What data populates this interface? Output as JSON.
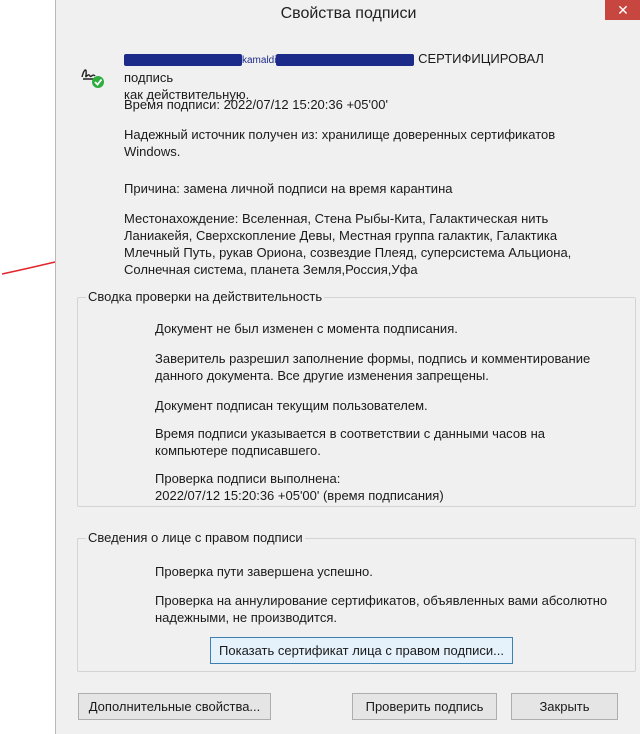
{
  "window": {
    "title": "Свойства подписи",
    "close_glyph": "✕"
  },
  "header": {
    "partial_name": "kamaldi",
    "certified_text": "СЕРТИФИЦИРОВАЛ подпись",
    "certified_text2": "как действительную.",
    "sign_time": "Время подписи:  2022/07/12 15:20:36 +05'00'",
    "trusted_source_1": "Надежный источник получен из: хранилище доверенных сертификатов",
    "trusted_source_2": "Windows.",
    "reason": "Причина:  замена личной подписи на время карантина",
    "location_1": "Местонахождение:  Вселенная, Стена Рыбы-Кита, Галактическая нить",
    "location_2": "Ланиакейя, Сверхскопление Девы, Местная группа галактик, Галактика",
    "location_3": "Млечный Путь, рукав Ориона, созвездие Плеяд, суперсистема Альциона,",
    "location_4": "Солнечная система, планета Земля,Россия,Уфа"
  },
  "validity": {
    "title": "Сводка проверки на действительность",
    "line1": "Документ  не был изменен с момента подписания.",
    "line2a": "Заверитель разрешил заполнение формы, подпись и комментирование",
    "line2b": "данного документа. Все другие изменения запрещены.",
    "line3": "Документ подписан текущим пользователем.",
    "line4a": "Время подписи указывается в соответствии с данными часов на",
    "line4b": "компьютере подписавшего.",
    "line5a": "Проверка подписи выполнена:",
    "line5b": "2022/07/12 15:20:36 +05'00' (время подписания)"
  },
  "signer": {
    "title": "Сведения о лице с правом подписи",
    "line1": "Проверка пути завершена успешно.",
    "line2a": "Проверка на аннулирование сертификатов, объявленных вами абсолютно",
    "line2b": "надежными, не производится.",
    "show_cert_button": "Показать сертификат лица с правом подписи..."
  },
  "footer": {
    "advanced_button": "Дополнительные свойства...",
    "verify_button": "Проверить подпись",
    "close_button": "Закрыть"
  },
  "colors": {
    "annotation_arrow": "#e2262d",
    "redaction": "#1c2a8a",
    "valid_check": "#2eae3e"
  }
}
